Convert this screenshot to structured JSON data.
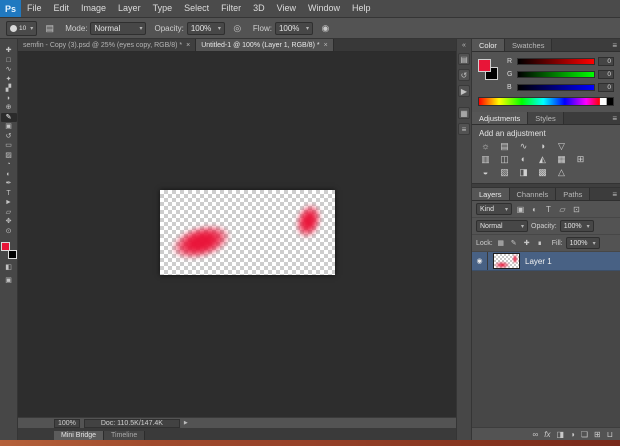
{
  "ui": {
    "caret": "▾",
    "close": "×",
    "panel_menu": "≡",
    "collapse": "«",
    "status_arrow": "▶",
    "eye": "◉"
  },
  "menubar": {
    "logo": "Ps",
    "items": [
      "File",
      "Edit",
      "Image",
      "Layer",
      "Type",
      "Select",
      "Filter",
      "3D",
      "View",
      "Window",
      "Help"
    ]
  },
  "options": {
    "brush_size": "10",
    "brush_panel_icon": "▤",
    "mode_label": "Mode:",
    "mode_value": "Normal",
    "opacity_label": "Opacity:",
    "opacity_value": "100%",
    "pressure_icon": "◎",
    "flow_label": "Flow:",
    "flow_value": "100%",
    "airbrush_icon": "◉"
  },
  "document_tabs": [
    {
      "label": "semfin - Copy (3).psd @ 25% (eyes copy, RGB/8) *"
    },
    {
      "label": "Untitled-1 @ 100% (Layer 1, RGB/8) *"
    }
  ],
  "toolbar": {
    "foreground_color": "#e81538",
    "background_color": "#000000",
    "quick_mask_icon": "◧",
    "screen_mode_icon": "▣",
    "tools": [
      {
        "name": "move",
        "glyph": "✚"
      },
      {
        "name": "rectangular-marquee",
        "glyph": "□"
      },
      {
        "name": "lasso",
        "glyph": "∿"
      },
      {
        "name": "quick-selection",
        "glyph": "✦"
      },
      {
        "name": "crop",
        "glyph": "▞"
      },
      {
        "name": "eyedropper",
        "glyph": "◗"
      },
      {
        "name": "spot-healing-brush",
        "glyph": "⊕"
      },
      {
        "name": "brush",
        "glyph": "✎"
      },
      {
        "name": "clone-stamp",
        "glyph": "▣"
      },
      {
        "name": "history-brush",
        "glyph": "↺"
      },
      {
        "name": "eraser",
        "glyph": "▭"
      },
      {
        "name": "gradient",
        "glyph": "▨"
      },
      {
        "name": "blur",
        "glyph": "◔"
      },
      {
        "name": "dodge",
        "glyph": "◐"
      },
      {
        "name": "pen",
        "glyph": "✒"
      },
      {
        "name": "horizontal-type",
        "glyph": "T"
      },
      {
        "name": "path-selection",
        "glyph": "►"
      },
      {
        "name": "rectangle-shape",
        "glyph": "▱"
      },
      {
        "name": "hand",
        "glyph": "✥"
      },
      {
        "name": "zoom",
        "glyph": "⊙"
      }
    ]
  },
  "dock": {
    "icons": [
      {
        "name": "properties-panel",
        "glyph": "▤"
      },
      {
        "name": "history-panel",
        "glyph": "↺"
      },
      {
        "name": "actions-panel",
        "glyph": "▶"
      },
      {
        "name": "info-panel",
        "glyph": "▦"
      },
      {
        "name": "navigator-panel",
        "glyph": "≡"
      }
    ]
  },
  "color_panel": {
    "tabs": [
      "Color",
      "Swatches"
    ],
    "sliders": [
      {
        "label": "R",
        "value": "0"
      },
      {
        "label": "G",
        "value": "0"
      },
      {
        "label": "B",
        "value": "0"
      }
    ]
  },
  "adjustments_panel": {
    "tabs": [
      "Adjustments",
      "Styles"
    ],
    "heading": "Add an adjustment",
    "rows": [
      [
        {
          "name": "brightness-contrast",
          "glyph": "☼"
        },
        {
          "name": "levels",
          "glyph": "▤"
        },
        {
          "name": "curves",
          "glyph": "∿"
        },
        {
          "name": "exposure",
          "glyph": "◑"
        },
        {
          "name": "vibrance",
          "glyph": "▽"
        }
      ],
      [
        {
          "name": "hue-saturation",
          "glyph": "▥"
        },
        {
          "name": "color-balance",
          "glyph": "◫"
        },
        {
          "name": "black-white",
          "glyph": "◐"
        },
        {
          "name": "photo-filter",
          "glyph": "◭"
        },
        {
          "name": "channel-mixer",
          "glyph": "▦"
        },
        {
          "name": "color-lookup",
          "glyph": "⊞"
        }
      ],
      [
        {
          "name": "invert",
          "glyph": "◒"
        },
        {
          "name": "posterize",
          "glyph": "▧"
        },
        {
          "name": "threshold",
          "glyph": "◨"
        },
        {
          "name": "gradient-map",
          "glyph": "▩"
        },
        {
          "name": "selective-color",
          "glyph": "△"
        }
      ]
    ]
  },
  "layers_panel": {
    "tabs": [
      "Layers",
      "Channels",
      "Paths"
    ],
    "kind_label": "Kind",
    "filter_icons": [
      {
        "name": "filter-pixel-layers",
        "glyph": "▣"
      },
      {
        "name": "filter-adjustment-layers",
        "glyph": "◐"
      },
      {
        "name": "filter-type-layers",
        "glyph": "T"
      },
      {
        "name": "filter-shape-layers",
        "glyph": "▱"
      },
      {
        "name": "filter-smart-objects",
        "glyph": "⊡"
      }
    ],
    "blend_mode": "Normal",
    "opacity_label": "Opacity:",
    "opacity_value": "100%",
    "lock_label": "Lock:",
    "lock_icons": [
      {
        "name": "lock-transparency",
        "glyph": "▦"
      },
      {
        "name": "lock-image",
        "glyph": "✎"
      },
      {
        "name": "lock-position",
        "glyph": "✚"
      },
      {
        "name": "lock-all",
        "glyph": "∎"
      }
    ],
    "fill_label": "Fill:",
    "fill_value": "100%",
    "layers": [
      {
        "name": "Layer 1"
      }
    ],
    "bottom_icons": [
      {
        "name": "link-layers",
        "glyph": "∞"
      },
      {
        "name": "layer-effects",
        "glyph": "fx"
      },
      {
        "name": "layer-mask",
        "glyph": "◨"
      },
      {
        "name": "adjustment-layer",
        "glyph": "◑"
      },
      {
        "name": "layer-group",
        "glyph": "❏"
      },
      {
        "name": "new-layer",
        "glyph": "⊞"
      },
      {
        "name": "delete-layer",
        "glyph": "⊔"
      }
    ]
  },
  "statusbar": {
    "zoom": "100%",
    "doc_info": "Doc: 110.5K/147.4K"
  },
  "bottom_tabs": [
    "Mini Bridge",
    "Timeline"
  ]
}
